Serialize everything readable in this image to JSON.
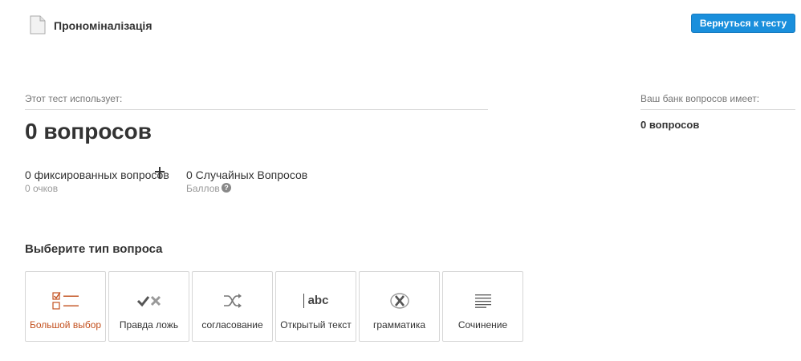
{
  "header": {
    "title": "Прономіналізація",
    "back_button": "Вернуться к тесту",
    "icon": "document-icon"
  },
  "summary": {
    "uses_label": "Этот тест использует:",
    "question_count": "0 вопросов",
    "fixed": {
      "label": "0 фиксированных вопросов",
      "points": "0 очков"
    },
    "random": {
      "label": "0 Случайных Вопросов",
      "points": "Баллов"
    }
  },
  "bank": {
    "label": "Ваш банк вопросов имеет:",
    "count": "0 вопросов"
  },
  "question_types": {
    "heading": "Выберите тип вопроса",
    "items": [
      {
        "label": "Большой выбор",
        "icon": "multiple-choice-icon",
        "active": true
      },
      {
        "label": "Правда ложь",
        "icon": "true-false-icon"
      },
      {
        "label": "согласование",
        "icon": "shuffle-icon"
      },
      {
        "label": "Открытый текст",
        "icon": "abc-text-icon",
        "icon_text": "abc"
      },
      {
        "label": "грамматика",
        "icon": "grammar-icon"
      },
      {
        "label": "Сочинение",
        "icon": "essay-lines-icon"
      }
    ]
  },
  "colors": {
    "accent_button": "#1a8fdc",
    "active_type": "#c3501e",
    "muted_text": "#999999"
  }
}
